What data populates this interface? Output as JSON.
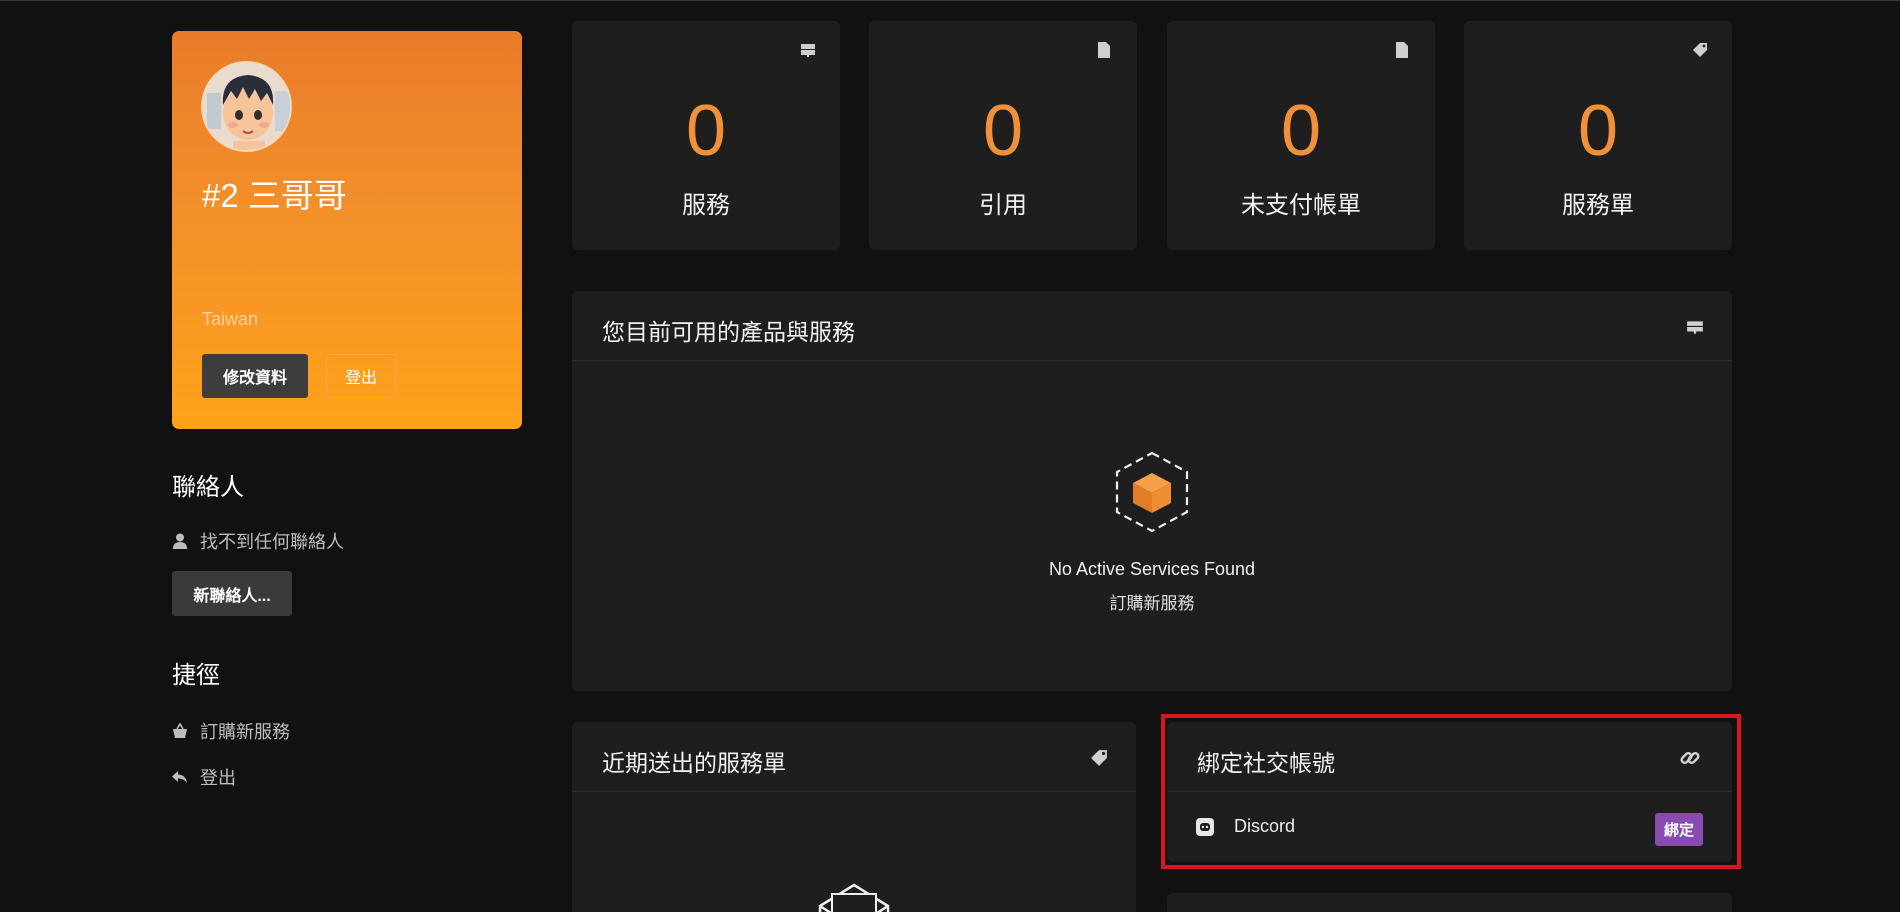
{
  "profile": {
    "name": "#2 三哥哥",
    "country": "Taiwan",
    "edit_label": "修改資料",
    "logout_label": "登出"
  },
  "contacts": {
    "heading": "聯絡人",
    "empty_text": "找不到任何聯絡人",
    "new_button": "新聯絡人..."
  },
  "shortcuts": {
    "heading": "捷徑",
    "items": [
      {
        "label": "訂購新服務",
        "icon": "basket-icon"
      },
      {
        "label": "登出",
        "icon": "back-arrow-icon"
      }
    ]
  },
  "stats": [
    {
      "value": "0",
      "label": "服務",
      "icon": "server-icon"
    },
    {
      "value": "0",
      "label": "引用",
      "icon": "document-icon"
    },
    {
      "value": "0",
      "label": "未支付帳單",
      "icon": "document-icon"
    },
    {
      "value": "0",
      "label": "服務單",
      "icon": "tag-icon"
    }
  ],
  "services_panel": {
    "title": "您目前可用的產品與服務",
    "empty_title": "No Active Services Found",
    "empty_link": "訂購新服務"
  },
  "tickets_panel": {
    "title": "近期送出的服務單"
  },
  "social_panel": {
    "title": "綁定社交帳號",
    "items": [
      {
        "name": "Discord",
        "action": "綁定"
      }
    ]
  },
  "colors": {
    "accent": "#f0913a",
    "bind_button": "#8a4bb0",
    "highlight": "#d9161c"
  }
}
